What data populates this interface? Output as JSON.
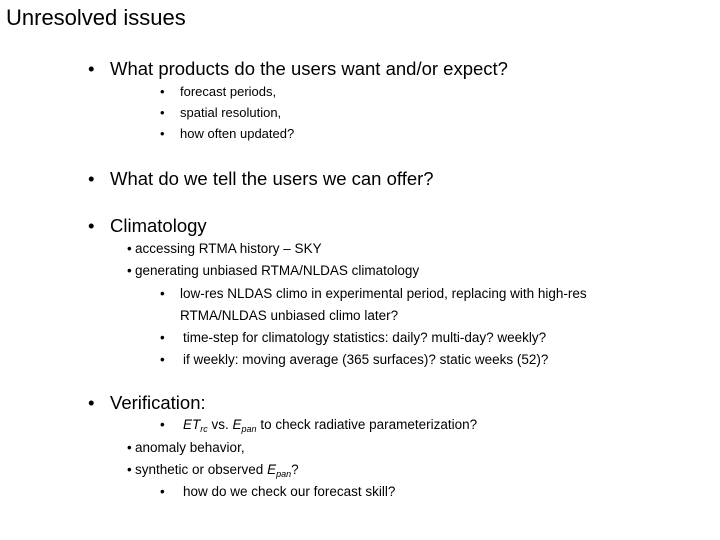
{
  "title": "Unresolved issues",
  "bullet_glyph": "•",
  "sections": {
    "products": {
      "heading": "What products do the users want and/or expect?",
      "items": [
        "forecast periods,",
        "spatial resolution,",
        "how often updated?"
      ]
    },
    "offer": {
      "heading": "What do we tell the users we can offer?"
    },
    "climatology": {
      "heading": "Climatology",
      "items": [
        "accessing RTMA history – SKY",
        "generating unbiased RTMA/NLDAS climatology"
      ],
      "subitems": [
        "low-res NLDAS climo in experimental period, replacing with high-res",
        "RTMA/NLDAS unbiased climo later?",
        "time-step for climatology statistics: daily? multi-day? weekly?",
        "if weekly: moving average (365 surfaces)? static weeks (52)?"
      ]
    },
    "verification": {
      "heading": "Verification:",
      "et_item": {
        "var1": "ET",
        "sub1": "rc",
        "mid": " vs. ",
        "var2": "E",
        "sub2": "pan",
        "rest": " to check radiative parameterization?"
      },
      "items": [
        "anomaly behavior,"
      ],
      "synthetic_item": {
        "text": "synthetic or observed ",
        "var": "E",
        "sub": "pan",
        "tail": "?"
      },
      "skill_item": "how do we check our forecast skill?"
    }
  }
}
